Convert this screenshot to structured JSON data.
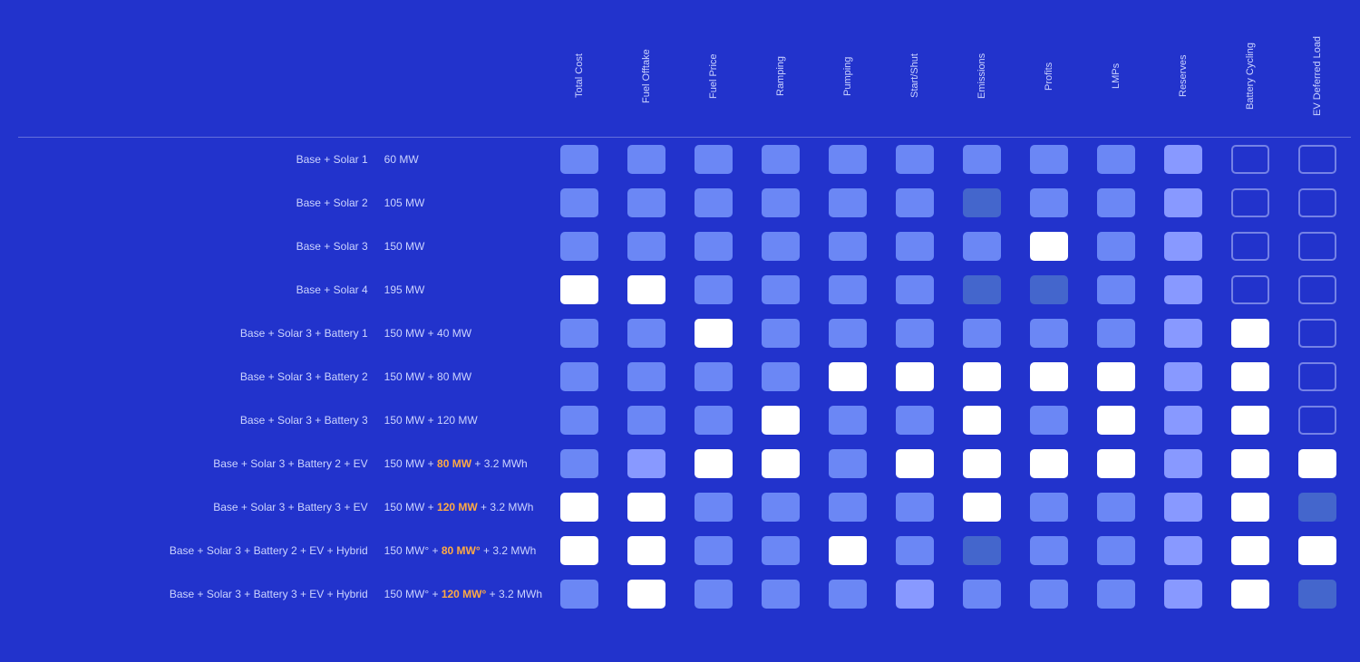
{
  "headers": {
    "columns": [
      "Total Cost",
      "Fuel Offtake",
      "Fuel Price",
      "Ramping",
      "Pumping",
      "Start/Shut",
      "Emissions",
      "Profits",
      "LMPs",
      "Reserves",
      "Battery Cycling",
      "EV Deferred Load"
    ]
  },
  "rows": [
    {
      "label": "Base + Solar 1",
      "mw": "60 MW",
      "mw_parts": [
        {
          "text": "60 MW",
          "orange": false
        }
      ],
      "cells": [
        "c0",
        "c0",
        "c0",
        "c0",
        "c0",
        "c0",
        "c0",
        "c0",
        "c0",
        "c3",
        "c2",
        "c2"
      ]
    },
    {
      "label": "Base + Solar 2",
      "mw": "105 MW",
      "mw_parts": [
        {
          "text": "105 MW",
          "orange": false
        }
      ],
      "cells": [
        "c0",
        "c0",
        "c0",
        "c0",
        "c0",
        "c0",
        "c4",
        "c0",
        "c0",
        "c3",
        "c2",
        "c2"
      ]
    },
    {
      "label": "Base + Solar 3",
      "mw": "150 MW",
      "mw_parts": [
        {
          "text": "150 MW",
          "orange": false
        }
      ],
      "cells": [
        "c0",
        "c0",
        "c0",
        "c0",
        "c0",
        "c0",
        "c0",
        "c1",
        "c0",
        "c3",
        "c2",
        "c2"
      ]
    },
    {
      "label": "Base + Solar 4",
      "mw": "195 MW",
      "mw_parts": [
        {
          "text": "195 MW",
          "orange": false
        }
      ],
      "cells": [
        "c1",
        "c1",
        "c0",
        "c0",
        "c0",
        "c0",
        "c4",
        "c4",
        "c0",
        "c3",
        "c2",
        "c2"
      ]
    },
    {
      "label": "Base + Solar 3 + Battery 1",
      "mw": "150 MW + 40 MW",
      "mw_parts": [
        {
          "text": "150 MW + 40 MW",
          "orange": false
        }
      ],
      "cells": [
        "c0",
        "c0",
        "c1",
        "c0",
        "c0",
        "c0",
        "c0",
        "c0",
        "c0",
        "c3",
        "c1",
        "c2"
      ]
    },
    {
      "label": "Base + Solar 3 + Battery 2",
      "mw": "150 MW + 80 MW",
      "mw_parts": [
        {
          "text": "150 MW + 80 MW",
          "orange": false
        }
      ],
      "cells": [
        "c0",
        "c0",
        "c0",
        "c0",
        "c1",
        "c1",
        "c1",
        "c1",
        "c1",
        "c3",
        "c1",
        "c2"
      ]
    },
    {
      "label": "Base + Solar 3 + Battery 3",
      "mw": "150 MW + 120 MW",
      "mw_parts": [
        {
          "text": "150 MW + 120 MW",
          "orange": false
        }
      ],
      "cells": [
        "c0",
        "c0",
        "c0",
        "c1",
        "c0",
        "c0",
        "c1",
        "c0",
        "c1",
        "c3",
        "c1",
        "c2"
      ]
    },
    {
      "label": "Base + Solar 3 + Battery 2 + EV",
      "mw": "150 MW + 80 MW + 3.2 MWh",
      "mw_parts": [
        {
          "text": "150 MW + ",
          "orange": false
        },
        {
          "text": "80 MW",
          "orange": true
        },
        {
          "text": " + 3.2 MWh",
          "orange": false
        }
      ],
      "cells": [
        "c0",
        "c3",
        "c1",
        "c1",
        "c0",
        "c1",
        "c1",
        "c1",
        "c1",
        "c3",
        "c1",
        "c1"
      ]
    },
    {
      "label": "Base + Solar 3 + Battery 3 + EV",
      "mw": "150 MW + 120 MW + 3.2 MWh",
      "mw_parts": [
        {
          "text": "150 MW + ",
          "orange": false
        },
        {
          "text": "120 MW",
          "orange": true
        },
        {
          "text": " + 3.2 MWh",
          "orange": false
        }
      ],
      "cells": [
        "c1",
        "c1",
        "c0",
        "c0",
        "c0",
        "c0",
        "c1",
        "c0",
        "c0",
        "c3",
        "c1",
        "c4"
      ]
    },
    {
      "label": "Base + Solar 3 + Battery 2 + EV + Hybrid",
      "mw": "150 MW° + 80 MW° + 3.2 MWh",
      "mw_parts": [
        {
          "text": "150 MW° + ",
          "orange": false
        },
        {
          "text": "80 MW°",
          "orange": true
        },
        {
          "text": " + 3.2 MWh",
          "orange": false
        }
      ],
      "cells": [
        "c1",
        "c1",
        "c0",
        "c0",
        "c1",
        "c0",
        "c4",
        "c0",
        "c0",
        "c3",
        "c1",
        "c1"
      ]
    },
    {
      "label": "Base + Solar 3 + Battery 3 + EV + Hybrid",
      "mw": "150 MW° + 120 MW° + 3.2 MWh",
      "mw_parts": [
        {
          "text": "150 MW° + ",
          "orange": false
        },
        {
          "text": "120 MW°",
          "orange": true
        },
        {
          "text": " + 3.2 MWh",
          "orange": false
        }
      ],
      "cells": [
        "c0",
        "c1",
        "c0",
        "c0",
        "c0",
        "c3",
        "c0",
        "c0",
        "c0",
        "c3",
        "c1",
        "c4"
      ]
    }
  ]
}
